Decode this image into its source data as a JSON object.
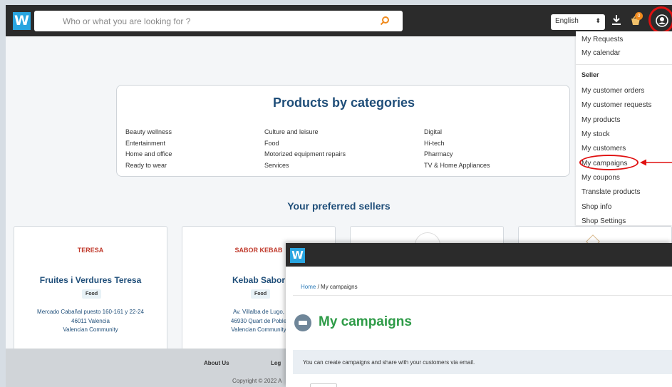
{
  "header": {
    "logo": "W",
    "search_placeholder": "Who or what you are looking for ?",
    "language": "English",
    "cart_count": "0"
  },
  "categories": {
    "title": "Products by categories",
    "col1": [
      "Beauty wellness",
      "Entertainment",
      "Home and office",
      "Ready to wear"
    ],
    "col2": [
      "Culture and leisure",
      "Food",
      "Motorized equipment repairs",
      "Services"
    ],
    "col3": [
      "Digital",
      "Hi-tech",
      "Pharmacy",
      "TV & Home Appliances"
    ]
  },
  "sellers": {
    "title": "Your preferred sellers",
    "cards": [
      {
        "logo": "TERESA",
        "name": "Fruites i Verdures Teresa",
        "tag": "Food",
        "address": [
          "Mercado Cabañal puesto 160-161 y 22-24",
          "46011 Valencia",
          "Valencian Community"
        ]
      },
      {
        "logo": "SABOR KEBAB",
        "name": "Kebab Sabor",
        "tag": "Food",
        "address": [
          "Av. Villalba de Lugo,",
          "46930 Quart de Poble",
          "Valencian Community"
        ]
      }
    ]
  },
  "footer": {
    "about": "About Us",
    "legal": "Leg",
    "copyright": "Copyright © 2022 A"
  },
  "menu": {
    "top_items": [
      "My Requests",
      "My calendar"
    ],
    "seller_heading": "Seller",
    "seller_items": [
      "My customer orders",
      "My customer requests",
      "My products",
      "My stock",
      "My customers",
      "My campaigns",
      "My coupons",
      "Translate products",
      "Shop info",
      "Shop Settings"
    ]
  },
  "overlay": {
    "logo": "W",
    "breadcrumb_home": "Home",
    "breadcrumb_sep": "/",
    "breadcrumb_current": "My campaigns",
    "title": "My campaigns",
    "info": "You can create campaigns and share with your customers via email."
  },
  "colors": {
    "accent_blue": "#29a5e0",
    "heading_navy": "#1f4e79",
    "title_green": "#2e9b47",
    "annotation_red": "#e01010",
    "topbar": "#2b2b2b"
  }
}
